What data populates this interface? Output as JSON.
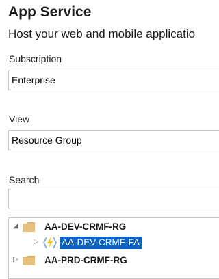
{
  "header": {
    "title": "App Service",
    "subtitle": "Host your web and mobile applicatio"
  },
  "subscription": {
    "label": "Subscription",
    "value": "Enterprise"
  },
  "view": {
    "label": "View",
    "value": "Resource Group"
  },
  "search": {
    "label": "Search",
    "value": ""
  },
  "tree": {
    "items": [
      {
        "label": "AA-DEV-CRMF-RG",
        "type": "resource-group",
        "expanded": true
      },
      {
        "label": "AA-DEV-CRMF-FA",
        "type": "function-app",
        "selected": true
      },
      {
        "label": "AA-PRD-CRMF-RG",
        "type": "resource-group",
        "expanded": false
      }
    ]
  },
  "colors": {
    "selection": "#0a63c9",
    "folder": "#d9b46a",
    "bolt": "#f7c600"
  }
}
